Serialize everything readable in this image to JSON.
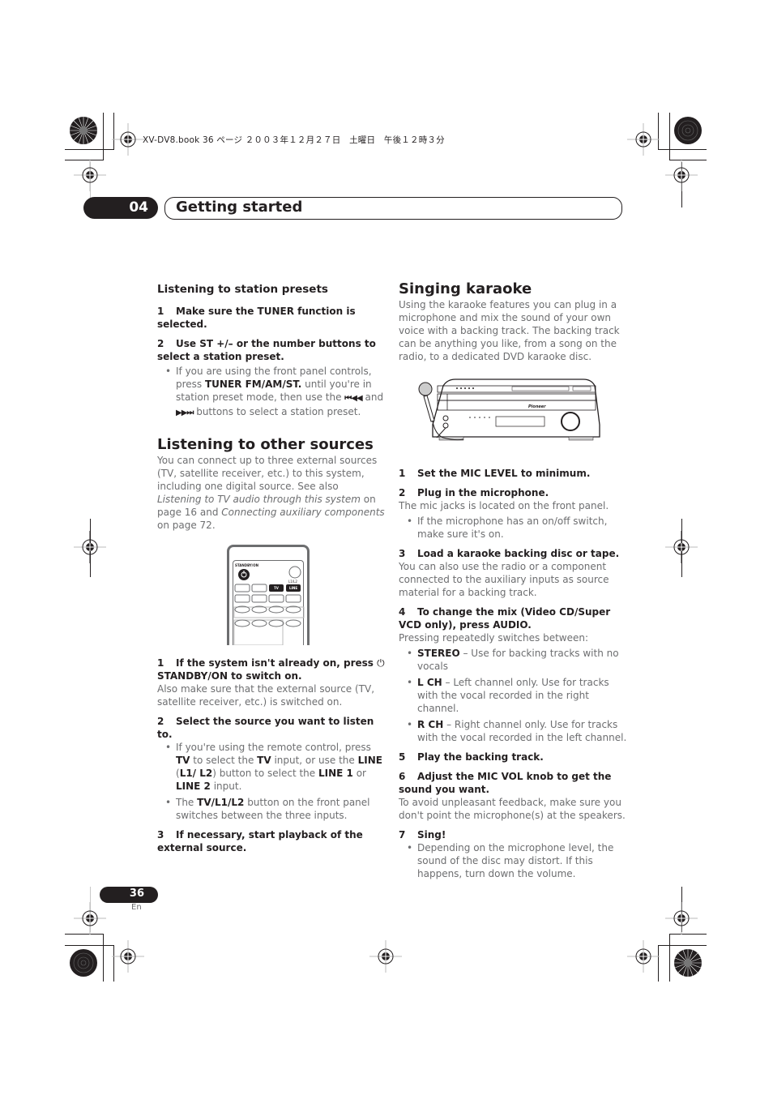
{
  "print_header": "XV-DV8.book  36 ページ  ２００３年１２月２７日　土曜日　午後１２時３分",
  "chapter": {
    "number": "04",
    "title": "Getting started"
  },
  "left_column": {
    "presets": {
      "heading": "Listening to station presets",
      "step1": {
        "num": "1",
        "text": "Make sure the TUNER function is selected."
      },
      "step2": {
        "num": "2",
        "text": "Use ST +/– or the number buttons to select a station preset."
      },
      "bullet": {
        "pre": "If you are using the front panel controls, press ",
        "bold": "TUNER FM/AM/ST.",
        "mid": " until you're in station preset mode, then use the ",
        "icon1": "⏮◀◀",
        "and": " and ",
        "icon2": "▶▶⏭",
        "post": " buttons to select a station preset."
      }
    },
    "other_sources": {
      "heading": "Listening to other sources",
      "intro_pre": "You can connect up to three external sources (TV, satellite receiver, etc.) to this system, including one digital source. See also ",
      "intro_link1": "Listening to TV audio through this system",
      "intro_mid": " on page 16 and ",
      "intro_link2": "Connecting auxiliary components",
      "intro_post": " on page 72.",
      "remote": {
        "standby_label": "STANDBY/ON",
        "l1l2_label": "L1/L2",
        "tv_label": "TV",
        "line_label": "LINE"
      },
      "step1": {
        "num": "1",
        "text_pre": "If the system isn't already on, press ",
        "icon": "⏻",
        "text_post": " STANDBY/ON to switch on."
      },
      "step1_body": "Also make sure that the external source (TV, satellite receiver, etc.) is switched on.",
      "step2": {
        "num": "2",
        "text": "Select the source you want to listen to."
      },
      "bullet1": {
        "p1": "If you're using the remote control, press ",
        "b1": "TV",
        "p2": " to select the ",
        "b2": "TV",
        "p3": " input, or use the ",
        "b3": "LINE",
        "p4": " (",
        "b4": "L1/ L2",
        "p5": ") button to select the ",
        "b5": "LINE 1",
        "p6": " or ",
        "b6": "LINE 2",
        "p7": " input."
      },
      "bullet2": {
        "p1": "The ",
        "b1": "TV/L1/L2",
        "p2": " button on the front panel switches between the three inputs."
      },
      "step3": {
        "num": "3",
        "text": "If necessary, start playback of the external source."
      }
    }
  },
  "right_column": {
    "heading": "Singing karaoke",
    "intro": "Using the karaoke features you can plug in a microphone and mix the sound of your own voice with a backing track. The backing track can be anything you like, from a song on the radio, to a dedicated DVD karaoke disc.",
    "device_brand": "Pioneer",
    "step1": {
      "num": "1",
      "text": "Set the MIC LEVEL to minimum."
    },
    "step2": {
      "num": "2",
      "text": "Plug in the microphone."
    },
    "step2_body": "The mic jacks is located on the front panel.",
    "step2_bullet": "If the microphone has an on/off switch, make sure it's on.",
    "step3": {
      "num": "3",
      "text": "Load a karaoke backing disc or tape."
    },
    "step3_body": "You can also use the radio or a component connected to the auxiliary inputs as source material for a backing track.",
    "step4": {
      "num": "4",
      "text": "To change the mix (Video CD/Super VCD only), press AUDIO."
    },
    "step4_body": "Pressing repeatedly switches between:",
    "mix_options": [
      {
        "label": "STEREO",
        "desc": " – Use for backing tracks with no vocals"
      },
      {
        "label": "L CH",
        "desc": " – Left channel only. Use for tracks with the vocal recorded in the right channel."
      },
      {
        "label": "R CH",
        "desc": " – Right channel only. Use for tracks with the vocal recorded in the left channel."
      }
    ],
    "step5": {
      "num": "5",
      "text": "Play the backing track."
    },
    "step6": {
      "num": "6",
      "text": "Adjust the MIC VOL knob to get the sound you want."
    },
    "step6_body": "To avoid unpleasant feedback, make sure you don't point the microphone(s) at the speakers.",
    "step7": {
      "num": "7",
      "text": "Sing!"
    },
    "step7_bullet": "Depending on the microphone level, the sound of the disc may distort. If this happens, turn down the volume."
  },
  "footer": {
    "page_number": "36",
    "language": "En"
  }
}
